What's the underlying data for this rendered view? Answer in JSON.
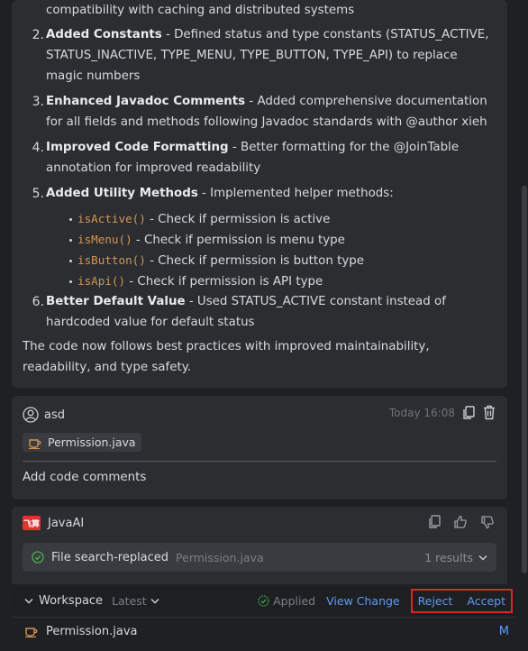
{
  "ai_response": {
    "continued_line": "compatibility with caching and distributed systems",
    "items": [
      {
        "num": "2.",
        "title": "Added Constants",
        "desc": " - Defined status and type constants (STATUS_ACTIVE, STATUS_INACTIVE, TYPE_MENU, TYPE_BUTTON, TYPE_API) to replace magic numbers"
      },
      {
        "num": "3.",
        "title": "Enhanced Javadoc Comments",
        "desc": " - Added comprehensive documentation for all fields and methods following Javadoc standards with @author xieh"
      },
      {
        "num": "4.",
        "title": "Improved Code Formatting",
        "desc": " - Better formatting for the @JoinTable annotation for improved readability"
      },
      {
        "num": "5.",
        "title": "Added Utility Methods",
        "desc": " - Implemented helper methods:"
      },
      {
        "num": "6.",
        "title": "Better Default Value",
        "desc": " - Used STATUS_ACTIVE constant instead of hardcoded value for default status"
      }
    ],
    "methods": [
      {
        "code": "isActive()",
        "desc": " - Check if permission is active"
      },
      {
        "code": "isMenu()",
        "desc": " - Check if permission is menu type"
      },
      {
        "code": "isButton()",
        "desc": " - Check if permission is button type"
      },
      {
        "code": "isApi()",
        "desc": " - Check if permission is API type"
      }
    ],
    "summary": "The code now follows best practices with improved maintainability, readability, and type safety."
  },
  "user_message": {
    "username": "asd",
    "timestamp": "Today 16:08",
    "attached_file": "Permission.java",
    "text": "Add code comments"
  },
  "javaai": {
    "name": "JavaAI",
    "logo_text": "飞算",
    "tool_action": "File search-replaced",
    "tool_file": "Permission.java",
    "tool_results": "1 results"
  },
  "workspace": {
    "title": "Workspace",
    "version": "Latest",
    "applied_label": "Applied",
    "view_changes": "View Change",
    "reject": "Reject",
    "accept": "Accept",
    "file_name": "Permission.java",
    "file_status": "M"
  },
  "colors": {
    "accent_link": "#5a9df5",
    "code_orange": "#d69454",
    "highlight_red": "#e02424",
    "check_green": "#4caf50"
  }
}
